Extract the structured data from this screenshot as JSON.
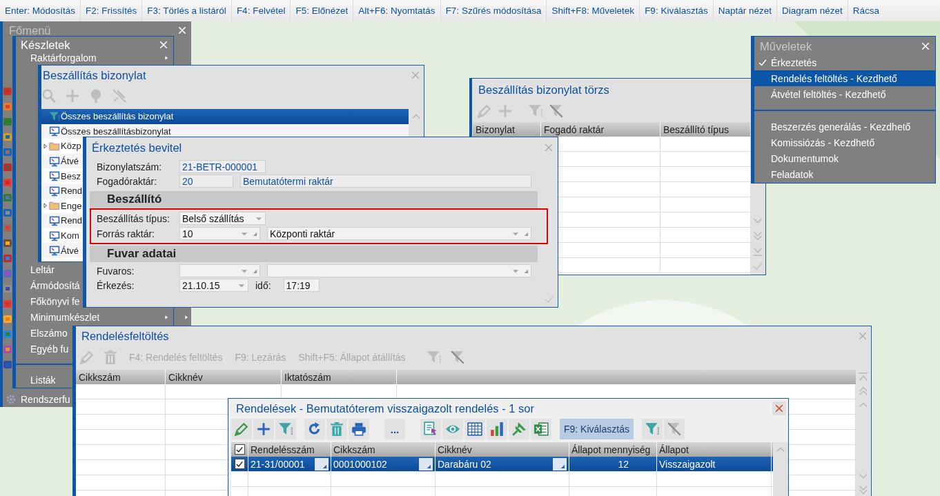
{
  "toolbar": [
    {
      "label": "Enter: Módosítás"
    },
    {
      "label": "F2: Frissítés"
    },
    {
      "label": "F3: Törlés a listáról"
    },
    {
      "label": "F4: Felvétel"
    },
    {
      "label": "F5: Előnézet"
    },
    {
      "label": "Alt+F6: Nyomtatás"
    },
    {
      "label": "F7: Szűrés módosítása"
    },
    {
      "label": "Shift+F8: Műveletek"
    },
    {
      "label": "F9: Kiválasztás"
    },
    {
      "label": "Naptár nézet"
    },
    {
      "label": "Diagram nézet"
    },
    {
      "label": "Rácsa"
    }
  ],
  "main_menu": {
    "title": "Főmenü",
    "items": [
      {
        "label": "Rendszerfu"
      }
    ]
  },
  "stock_menu": {
    "title": "Készletek",
    "top_items": [
      {
        "kind": "item",
        "label": "Raktárforgalom",
        "submenu": true
      }
    ],
    "items": [
      {
        "kind": "item",
        "label": "Leltár",
        "submenu": false
      },
      {
        "kind": "item",
        "label": "Ármódosítá",
        "submenu": false
      },
      {
        "kind": "item",
        "label": "Főkönyvi fe",
        "submenu": false
      },
      {
        "kind": "item",
        "label": "Minimumkészlet",
        "submenu": true
      },
      {
        "kind": "item",
        "label": "Elszámo",
        "submenu": false
      },
      {
        "kind": "item",
        "label": "Egyéb fu",
        "submenu": false
      },
      {
        "kind": "separator"
      },
      {
        "kind": "item",
        "label": "Listák",
        "submenu": false
      }
    ]
  },
  "documents_window": {
    "title": "Beszállítás bizonylat",
    "toolbar_groups": [
      [
        {
          "kind": "search",
          "disabled": true
        },
        {
          "kind": "add",
          "disabled": true
        },
        {
          "kind": "tree",
          "disabled": true
        },
        {
          "kind": "unpin",
          "disabled": true
        }
      ]
    ],
    "tree": [
      {
        "kind": "filter",
        "label": "Összes beszállítás bizonylat",
        "selected": true
      },
      {
        "kind": "view",
        "label": "Összes beszállításbizonylat",
        "selected": false
      },
      {
        "kind": "folder",
        "label": "Közp",
        "selected": false
      },
      {
        "kind": "view",
        "label": "Átvé",
        "selected": false
      },
      {
        "kind": "view",
        "label": "Besz",
        "selected": false
      },
      {
        "kind": "view",
        "label": "Rend",
        "selected": false
      },
      {
        "kind": "folder",
        "label": "Enge",
        "selected": false
      },
      {
        "kind": "view",
        "label": "Rend",
        "selected": false
      },
      {
        "kind": "view",
        "label": "Kom",
        "selected": false
      },
      {
        "kind": "view",
        "label": "Átvé",
        "selected": false
      }
    ]
  },
  "register_window": {
    "title": "Beszállítás bizonylat törzs",
    "toolbar_groups": [
      [
        {
          "kind": "edit",
          "disabled": true
        },
        {
          "kind": "add",
          "disabled": true
        }
      ],
      [
        {
          "kind": "filter",
          "disabled": true
        },
        {
          "kind": "filter-clear",
          "disabled": true
        }
      ]
    ],
    "columns": [
      "Bizonylat",
      "Fogadó raktár",
      "Beszállító típus"
    ]
  },
  "operations_menu": {
    "title": "Műveletek",
    "items": [
      {
        "kind": "item",
        "label": "Érkeztetés",
        "checked": true,
        "selected": false
      },
      {
        "kind": "item",
        "label": "Rendelés feltöltés - Kezdhető",
        "checked": false,
        "selected": true
      },
      {
        "kind": "item",
        "label": "Átvétel feltöltés - Kezdhető",
        "checked": false,
        "selected": false
      },
      {
        "kind": "separator"
      },
      {
        "kind": "item",
        "label": "Beszerzés generálás - Kezdhető",
        "checked": false,
        "selected": false
      },
      {
        "kind": "item",
        "label": "Komissiózás - Kezdhető",
        "checked": false,
        "selected": false
      },
      {
        "kind": "item",
        "label": "Dokumentumok",
        "checked": false,
        "selected": false
      },
      {
        "kind": "item",
        "label": "Feladatok",
        "checked": false,
        "selected": false
      }
    ]
  },
  "entry_form": {
    "title": "Érkeztetés bevitel",
    "header_rows": [
      {
        "label": "Bizonylatszám:",
        "inputs": [
          {
            "kind": "text",
            "value": "21-BETR-000001",
            "readonly": true
          }
        ]
      },
      {
        "label": "Fogadóraktár:",
        "inputs": [
          {
            "kind": "text",
            "value": "20",
            "readonly": true
          },
          {
            "kind": "text",
            "value": "Bemutatótermi raktár",
            "readonly": true
          }
        ]
      }
    ],
    "sections": [
      {
        "title": "Beszállító",
        "highlighted": true,
        "rows": [
          {
            "label": "Beszállítás típus:",
            "inputs": [
              {
                "kind": "dropdown",
                "value": "Belső szállítás",
                "readonly": false
              }
            ]
          },
          {
            "label": "Forrás raktár:",
            "inputs": [
              {
                "kind": "lookup",
                "value": "10",
                "readonly": false
              },
              {
                "kind": "lookup",
                "value": "Központi raktár",
                "readonly": false
              }
            ]
          }
        ]
      },
      {
        "title": "Fuvar adatai",
        "highlighted": false,
        "rows": [
          {
            "label": "Fuvaros:",
            "inputs": [
              {
                "kind": "lookup"
              },
              {
                "kind": "lookup"
              }
            ]
          },
          {
            "label": "Érkezés:",
            "inputs": [
              {
                "kind": "date",
                "value": "21.10.15",
                "readonly": false
              },
              {
                "kind": "label",
                "value": "idő:"
              },
              {
                "kind": "text",
                "value": "17:19",
                "readonly": false
              }
            ]
          }
        ]
      }
    ]
  },
  "upload_window": {
    "title": "Rendelésfeltöltés",
    "toolbar_groups": [
      [
        {
          "kind": "edit",
          "disabled": true
        },
        {
          "kind": "delete",
          "disabled": true
        }
      ],
      [
        {
          "kind": "text",
          "label": "F4: Rendelés feltöltés",
          "disabled": true
        }
      ],
      [
        {
          "kind": "text",
          "label": "F9: Lezárás",
          "disabled": true
        }
      ],
      [
        {
          "kind": "text",
          "label": "Shift+F5: Állapot átállítás",
          "disabled": true
        }
      ],
      [
        {
          "kind": "filter",
          "disabled": true
        },
        {
          "kind": "filter-clear",
          "disabled": true
        }
      ]
    ],
    "columns": [
      "Cikkszám",
      "Cikknév",
      "Iktatószám"
    ]
  },
  "orders_window": {
    "title": "Rendelések - Bemutatóterem visszaigazolt rendelés - 1 sor",
    "toolbar_groups": [
      [
        {
          "kind": "edit",
          "disabled": false
        },
        {
          "kind": "add",
          "disabled": false
        },
        {
          "kind": "filter",
          "disabled": false
        }
      ],
      [
        {
          "kind": "refresh",
          "disabled": false
        },
        {
          "kind": "delete",
          "disabled": false
        },
        {
          "kind": "print",
          "disabled": false
        }
      ],
      [
        {
          "kind": "more",
          "label": "...",
          "disabled": false
        }
      ],
      [
        {
          "kind": "report",
          "disabled": false
        },
        {
          "kind": "view",
          "disabled": false
        },
        {
          "kind": "grid",
          "disabled": false
        },
        {
          "kind": "chart",
          "disabled": false
        },
        {
          "kind": "pin",
          "disabled": false
        },
        {
          "kind": "excel",
          "disabled": false
        }
      ],
      [
        {
          "kind": "text",
          "label": "F9: Kiválasztás",
          "disabled": false
        }
      ],
      [
        {
          "kind": "filter",
          "disabled": false
        },
        {
          "kind": "filter-clear",
          "disabled": true
        }
      ]
    ],
    "all_checked": true,
    "columns": [
      {
        "label": "Rendelésszám",
        "kind": "lookup"
      },
      {
        "label": "Cikkszám",
        "kind": "lookup"
      },
      {
        "label": "Cikknév",
        "kind": "lookup"
      },
      {
        "label": "Állapot mennyiség",
        "kind": "number"
      },
      {
        "label": "Állapot",
        "kind": "text"
      }
    ],
    "rows": [
      {
        "checked": true,
        "selected": true,
        "cells": [
          "21-31/00001",
          "0001000102",
          "Darabáru 02",
          "12",
          "Visszaigazolt"
        ]
      }
    ]
  }
}
